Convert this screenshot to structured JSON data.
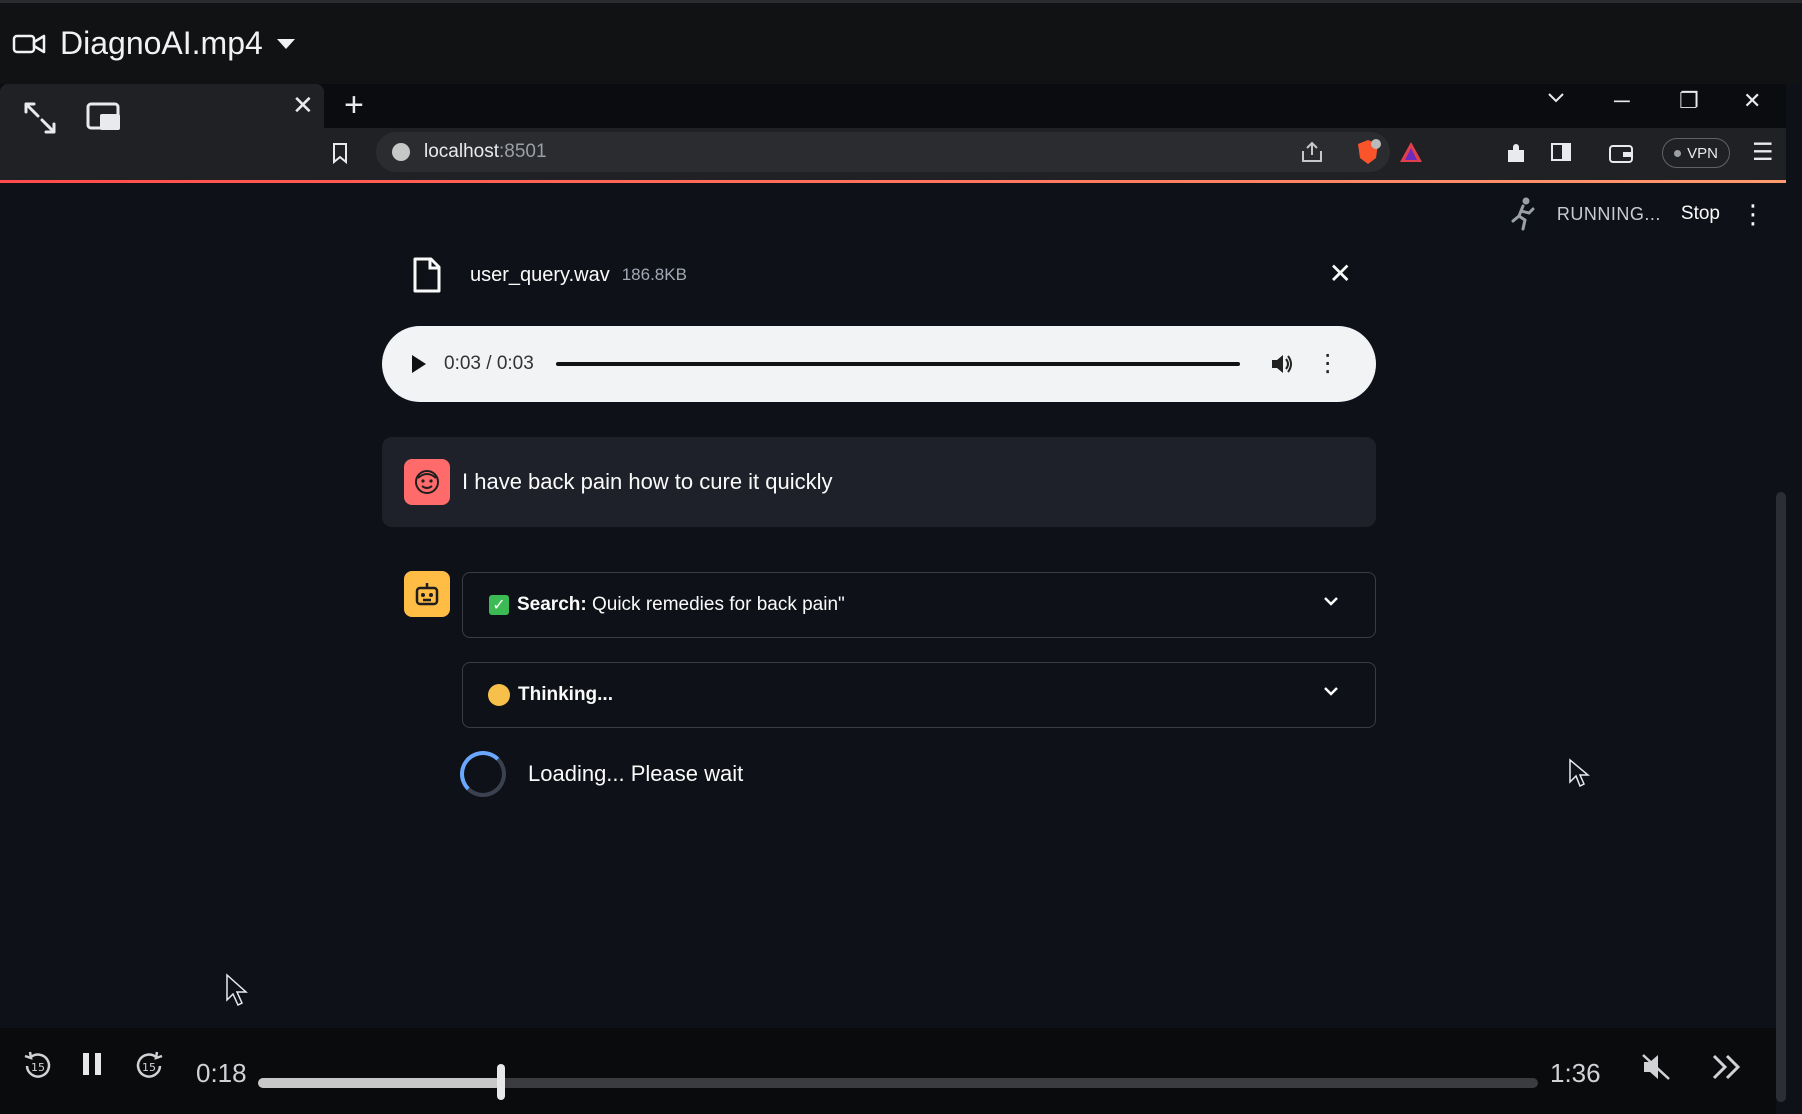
{
  "player": {
    "title": "DiagnoAI.mp4",
    "current_time": "0:18",
    "total_time": "1:36",
    "progress": 0.19
  },
  "browser": {
    "url_host": "localhost",
    "url_port": ":8501",
    "vpn_label": "VPN"
  },
  "app": {
    "status": "RUNNING...",
    "stop_label": "Stop",
    "file": {
      "name": "user_query.wav",
      "size": "186.8KB"
    },
    "audio": {
      "time": "0:03 / 0:03"
    },
    "user_message": "I have back pain how to cure it quickly",
    "search_expander": {
      "label_bold": "Search:",
      "label": " Quick remedies for back pain\""
    },
    "thinking_expander": {
      "label": "Thinking..."
    },
    "loading_text": "Loading... Please wait"
  },
  "colors": {
    "accent_red": "#ff4b4b",
    "user_avatar": "#ff6b6b",
    "bot_avatar": "#ffbd45",
    "success": "#3cba54",
    "spinner": "#6aa8ff"
  },
  "icons": [
    "video-camera-icon",
    "caret-down-icon",
    "collapse-icon",
    "picture-in-picture-icon",
    "bookmark-icon",
    "info-icon",
    "share-icon",
    "brave-shield-icon",
    "brave-rewards-icon",
    "extensions-icon",
    "sidebar-icon",
    "wallet-icon",
    "menu-icon",
    "running-icon",
    "file-icon",
    "close-icon",
    "play-icon",
    "volume-icon",
    "more-icon",
    "user-face-icon",
    "robot-icon",
    "check-icon",
    "thinking-face-icon",
    "chevron-down-icon",
    "spinner-icon",
    "rewind-15-icon",
    "pause-icon",
    "forward-15-icon",
    "mute-icon",
    "skip-forward-icon"
  ]
}
